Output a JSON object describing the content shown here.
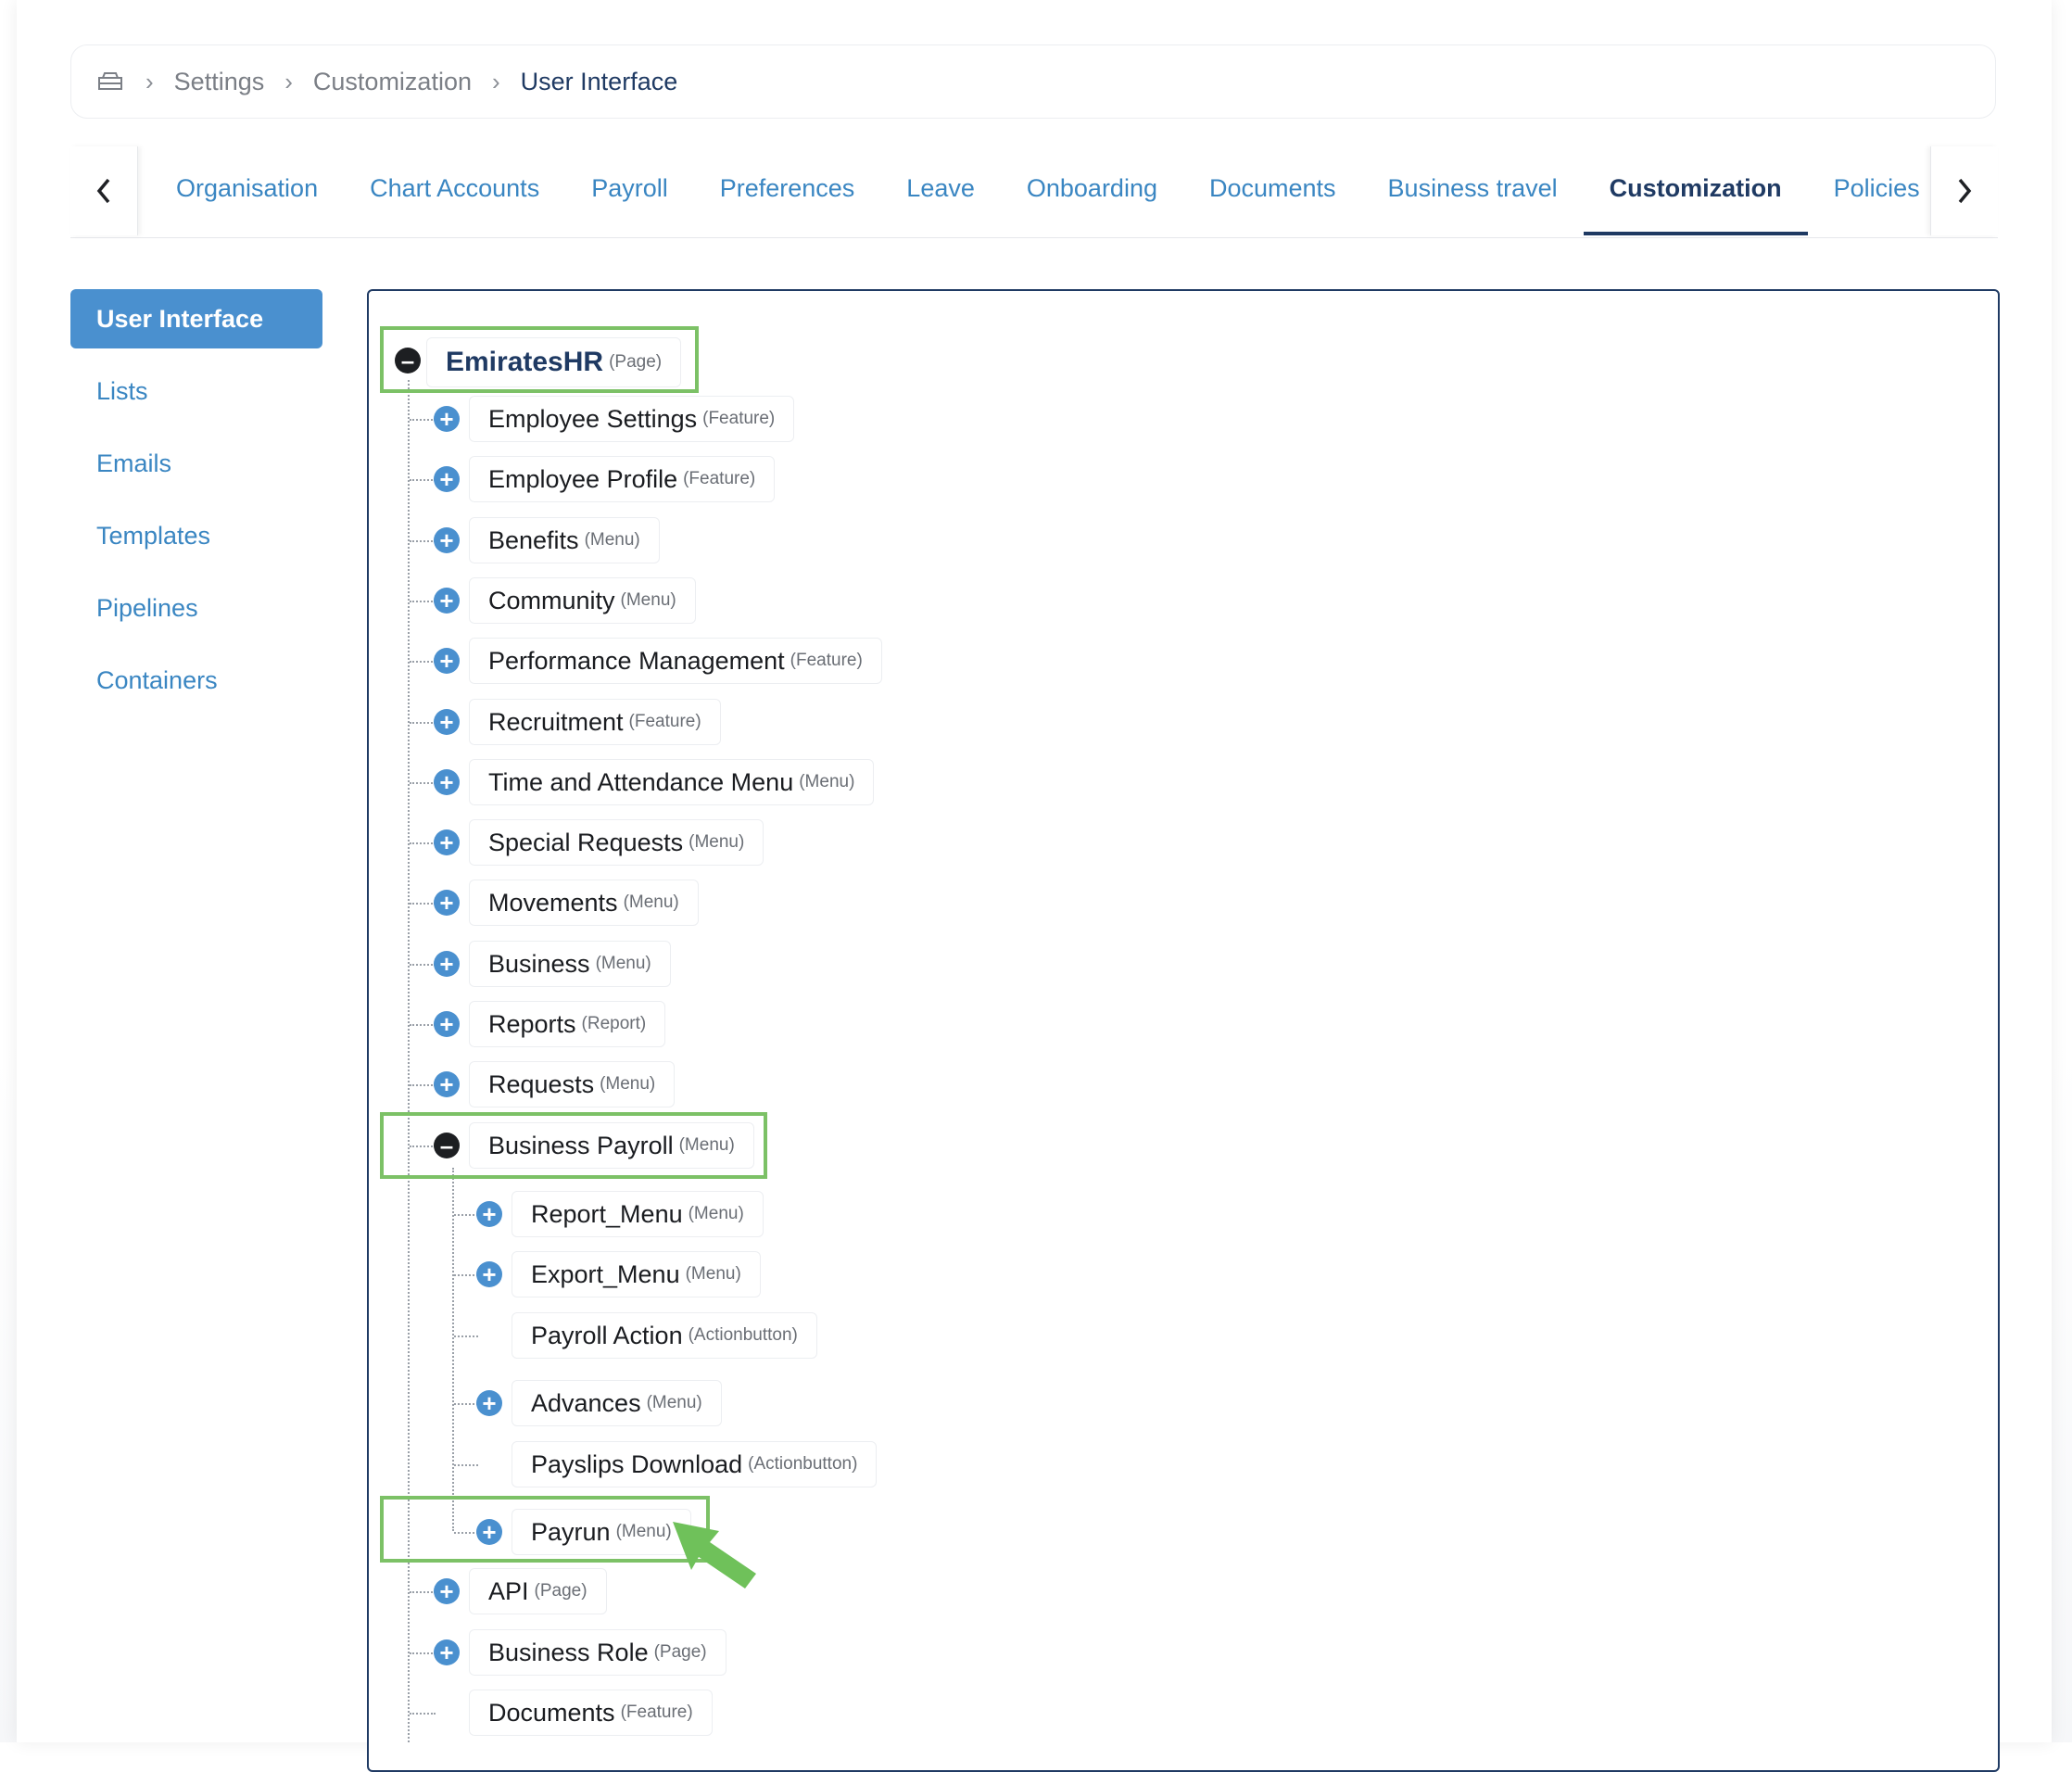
{
  "breadcrumb": {
    "home_icon": "home-icon",
    "items": [
      "Settings",
      "Customization",
      "User Interface"
    ]
  },
  "tabs": {
    "items": [
      "Organisation",
      "Chart Accounts",
      "Payroll",
      "Preferences",
      "Leave",
      "Onboarding",
      "Documents",
      "Business travel",
      "Customization",
      "Policies"
    ],
    "active": "Customization"
  },
  "sidebar": {
    "items": [
      "User Interface",
      "Lists",
      "Emails",
      "Templates",
      "Pipelines",
      "Containers"
    ],
    "active": "User Interface"
  },
  "tree": {
    "root": {
      "label": "EmiratesHR",
      "type": "(Page)"
    },
    "level1": [
      {
        "label": "Employee Settings",
        "type": "(Feature)"
      },
      {
        "label": "Employee Profile",
        "type": "(Feature)"
      },
      {
        "label": "Benefits",
        "type": "(Menu)"
      },
      {
        "label": "Community",
        "type": "(Menu)"
      },
      {
        "label": "Performance Management",
        "type": "(Feature)"
      },
      {
        "label": "Recruitment",
        "type": "(Feature)"
      },
      {
        "label": "Time and Attendance Menu",
        "type": "(Menu)"
      },
      {
        "label": "Special Requests",
        "type": "(Menu)"
      },
      {
        "label": "Movements",
        "type": "(Menu)"
      },
      {
        "label": "Business",
        "type": "(Menu)"
      },
      {
        "label": "Reports",
        "type": "(Report)"
      },
      {
        "label": "Requests",
        "type": "(Menu)"
      },
      {
        "label": "Business Payroll",
        "type": "(Menu)"
      }
    ],
    "business_payroll_children": [
      {
        "label": "Report_Menu",
        "type": "(Menu)"
      },
      {
        "label": "Export_Menu",
        "type": "(Menu)"
      },
      {
        "label": "Payroll Action",
        "type": "(Actionbutton)"
      },
      {
        "label": "Advances",
        "type": "(Menu)"
      },
      {
        "label": "Payslips Download",
        "type": "(Actionbutton)"
      },
      {
        "label": "Payrun",
        "type": "(Menu)"
      }
    ],
    "level1_after": [
      {
        "label": "API",
        "type": "(Page)"
      },
      {
        "label": "Business Role",
        "type": "(Page)"
      },
      {
        "label": "Documents",
        "type": "(Feature)"
      }
    ]
  },
  "colors": {
    "accent": "#4a90cf",
    "navy": "#1f3a63",
    "highlight": "#7cc166"
  }
}
